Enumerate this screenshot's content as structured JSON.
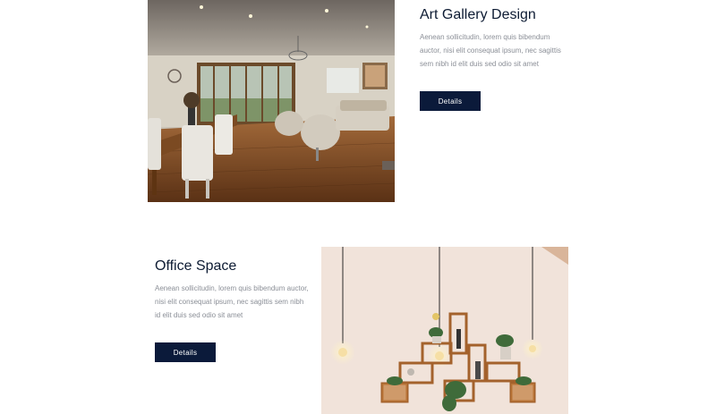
{
  "sections": [
    {
      "title": "Art Gallery Design",
      "description": "Aenean sollicitudin, lorem quis bibendum auctor, nisi elit consequat ipsum, nec sagittis sem nibh id elit duis sed odio sit amet",
      "button_label": "Details",
      "image_icon": "living-room-photo"
    },
    {
      "title": "Office Space",
      "description": "Aenean sollicitudin, lorem quis bibendum auctor, nisi elit consequat ipsum, nec sagittis sem nibh id elit duis sed odio sit amet",
      "button_label": "Details",
      "image_icon": "wall-shelves-photo"
    }
  ],
  "colors": {
    "heading": "#0d1b33",
    "body_text": "#8b8f97",
    "button_bg": "#0b1a3a",
    "button_text": "#ffffff"
  }
}
